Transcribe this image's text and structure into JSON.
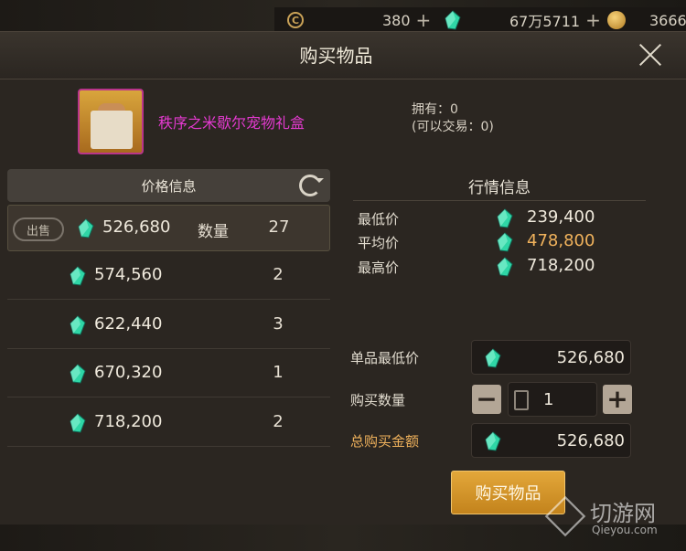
{
  "topbar": {
    "currency1_value": "380",
    "currency2_value": "67万5711",
    "currency3_value": "3666",
    "currency1_icon": "c-coin-icon",
    "currency2_icon": "gem-icon",
    "currency3_icon": "gold-coin-icon"
  },
  "dialog": {
    "title": "购买物品",
    "item_name": "秩序之米歇尔宠物礼盒",
    "owned_label": "拥有：0",
    "tradeable_label": "(可以交易：0)"
  },
  "price_info": {
    "heading": "价格信息",
    "sell_button": "出售",
    "quantity_label": "数量",
    "rows": [
      {
        "price": "526,680",
        "qty": "27"
      },
      {
        "price": "574,560",
        "qty": "2"
      },
      {
        "price": "622,440",
        "qty": "3"
      },
      {
        "price": "670,320",
        "qty": "1"
      },
      {
        "price": "718,200",
        "qty": "2"
      }
    ]
  },
  "market": {
    "heading": "行情信息",
    "lowest_label": "最低价",
    "lowest_value": "239,400",
    "average_label": "平均价",
    "average_value": "478,800",
    "highest_label": "最高价",
    "highest_value": "718,200"
  },
  "purchase": {
    "unit_min_label": "单品最低价",
    "unit_min_value": "526,680",
    "quantity_label": "购买数量",
    "quantity_value": "1",
    "total_label": "总购买金额",
    "total_value": "526,680",
    "buy_button": "购买物品"
  },
  "watermark": {
    "text": "切游网",
    "sub": "Qieyou.com"
  },
  "colors": {
    "item_name": "#e43ad0",
    "accent_gold": "#f0b25c",
    "buy_button": "#d6972c",
    "gem": "#2fd6a6"
  }
}
